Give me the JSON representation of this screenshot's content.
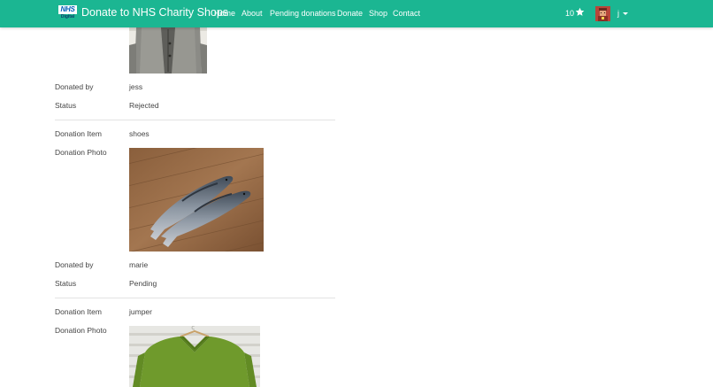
{
  "navbar": {
    "logo": {
      "top": "NHS",
      "bottom": "Digital"
    },
    "brand": "Donate to NHS Charity Shops",
    "links": [
      "Home",
      "About",
      "Pending donations",
      "Donate",
      "Shop",
      "Contact"
    ],
    "points": "10",
    "user": "j",
    "accent_color": "#1bb692"
  },
  "labels": {
    "donated_by": "Donated by",
    "status": "Status",
    "item": "Donation Item",
    "photo": "Donation Photo"
  },
  "donations": [
    {
      "item": "",
      "donor": "jess",
      "status": "Rejected"
    },
    {
      "item": "shoes",
      "donor": "marie",
      "status": "Pending"
    },
    {
      "item": "jumper"
    }
  ]
}
